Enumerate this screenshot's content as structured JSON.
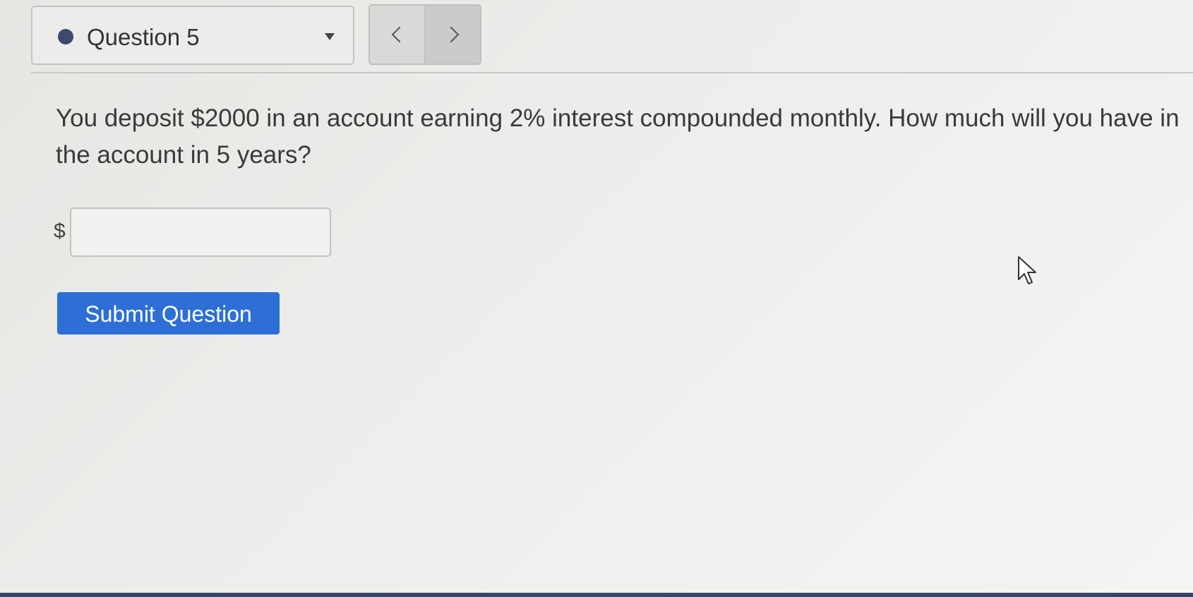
{
  "header": {
    "question_label": "Question 5",
    "status_color": "#3d4a6e",
    "dropdown_icon": "caret-down-icon",
    "prev_icon": "chevron-left-icon",
    "next_icon": "chevron-right-icon"
  },
  "question": {
    "text": "You deposit $2000 in an account earning 2% interest compounded monthly. How much will you have in the account in 5 years?"
  },
  "answer": {
    "currency_symbol": "$",
    "value": "",
    "placeholder": ""
  },
  "actions": {
    "submit_label": "Submit Question",
    "submit_color": "#2d6fd6"
  }
}
